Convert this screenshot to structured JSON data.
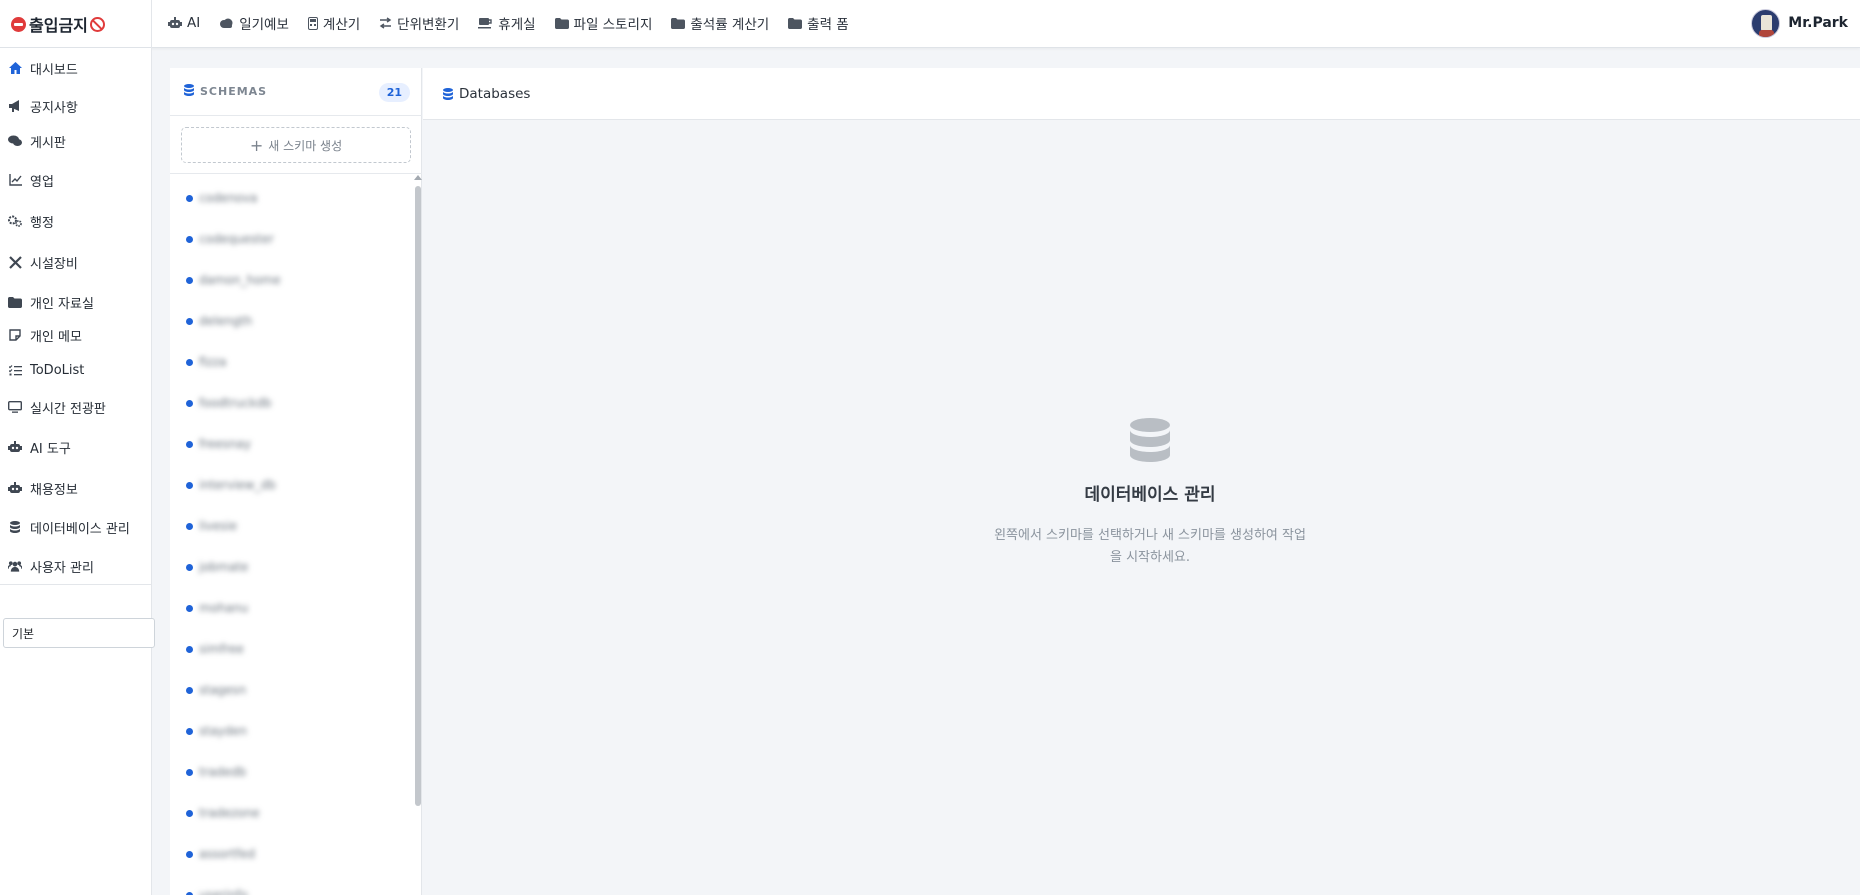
{
  "brand": {
    "title": "출입금지"
  },
  "topnav": [
    {
      "label": "AI",
      "icon": "robot-icon"
    },
    {
      "label": "일기예보",
      "icon": "cloud-icon"
    },
    {
      "label": "계산기",
      "icon": "calculator-icon"
    },
    {
      "label": "단위변환기",
      "icon": "exchange-icon"
    },
    {
      "label": "휴게실",
      "icon": "coffee-icon"
    },
    {
      "label": "파일 스토리지",
      "icon": "folder-icon"
    },
    {
      "label": "출석률 계산기",
      "icon": "folder-icon"
    },
    {
      "label": "출력 폼",
      "icon": "folder-icon"
    }
  ],
  "user": {
    "name": "Mr.Park"
  },
  "sidebar": {
    "items": [
      {
        "label": "대시보드",
        "icon": "home-icon"
      },
      {
        "label": "공지사항",
        "icon": "megaphone-icon"
      },
      {
        "label": "게시판",
        "icon": "comments-icon"
      },
      {
        "label": "영업",
        "icon": "line-chart-icon"
      },
      {
        "label": "행정",
        "icon": "gears-icon"
      },
      {
        "label": "시설장비",
        "icon": "tools-icon"
      },
      {
        "label": "개인 자료실",
        "icon": "folder-icon"
      },
      {
        "label": "개인 메모",
        "icon": "note-icon"
      },
      {
        "label": "ToDoList",
        "icon": "checklist-icon"
      },
      {
        "label": "실시간 전광판",
        "icon": "monitor-icon"
      },
      {
        "label": "AI 도구",
        "icon": "robot-icon"
      },
      {
        "label": "채용정보",
        "icon": "robot-icon"
      },
      {
        "label": "데이터베이스 관리",
        "icon": "database-icon"
      },
      {
        "label": "사용자 관리",
        "icon": "users-icon"
      }
    ],
    "theme_select": "기본"
  },
  "schemas": {
    "title": "SCHEMAS",
    "count": "21",
    "new_button": "새 스키마 생성",
    "items": [
      "codenova",
      "codequester",
      "damon_home",
      "delength",
      "fizza",
      "foodtruckdb",
      "freesnay",
      "interview_db",
      "livesie",
      "jobmate",
      "mohanu",
      "simfree",
      "stagesn",
      "stayden",
      "tradedb",
      "tradezone",
      "assortfed",
      "userinfo"
    ]
  },
  "main": {
    "header": "Databases",
    "empty_title": "데이터베이스 관리",
    "empty_desc": "왼쪽에서 스키마를 선택하거나 새 스키마를 생성하여 작업을 시작하세요."
  },
  "colors": {
    "accent": "#1f63d8",
    "brand_red": "#e03b3b",
    "page_bg": "#f3f5f8"
  }
}
